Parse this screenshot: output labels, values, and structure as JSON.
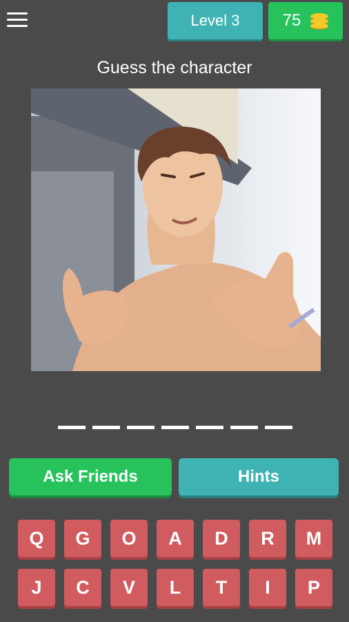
{
  "header": {
    "menu_icon": "hamburger-menu-icon",
    "level_label": "Level 3",
    "coins": "75",
    "coin_icon": "coin-stack-icon"
  },
  "prompt": "Guess the character",
  "answer_length": 7,
  "actions": {
    "ask_friends": "Ask Friends",
    "hints": "Hints"
  },
  "keyboard": {
    "row1": [
      "Q",
      "G",
      "O",
      "A",
      "D",
      "R",
      "M"
    ],
    "row2": [
      "J",
      "C",
      "V",
      "L",
      "T",
      "I",
      "P"
    ]
  },
  "colors": {
    "background": "#4a4a4a",
    "teal": "#3fb3b3",
    "green": "#27c25c",
    "key_red": "#d15c5f"
  }
}
